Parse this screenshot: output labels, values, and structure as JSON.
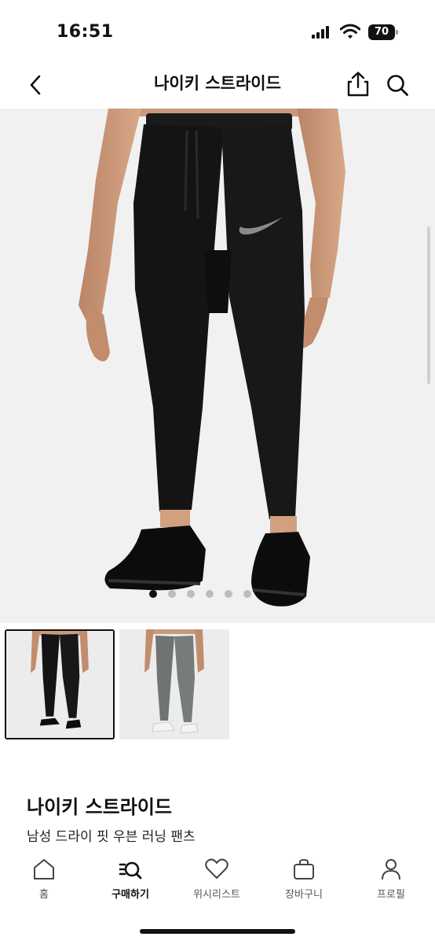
{
  "status_bar": {
    "time": "16:51",
    "battery_level": "70"
  },
  "header": {
    "title": "나이키 스트라이드",
    "back_icon": "chevron-left-icon",
    "share_icon": "share-icon",
    "search_icon": "search-icon"
  },
  "gallery": {
    "image_count": 6,
    "active_index": 0,
    "thumbnails": [
      {
        "color": "black",
        "selected": true
      },
      {
        "color": "grey",
        "selected": false
      }
    ]
  },
  "product": {
    "name": "나이키 스트라이드",
    "subtitle": "남성 드라이 핏 우븐 러닝 팬츠"
  },
  "bottom_nav": {
    "items": [
      {
        "label": "홈",
        "icon": "home-icon",
        "active": false
      },
      {
        "label": "구매하기",
        "icon": "shop-search-icon",
        "active": true
      },
      {
        "label": "위시리스트",
        "icon": "heart-icon",
        "active": false
      },
      {
        "label": "장바구니",
        "icon": "bag-icon",
        "active": false
      },
      {
        "label": "프로필",
        "icon": "profile-icon",
        "active": false
      }
    ]
  }
}
